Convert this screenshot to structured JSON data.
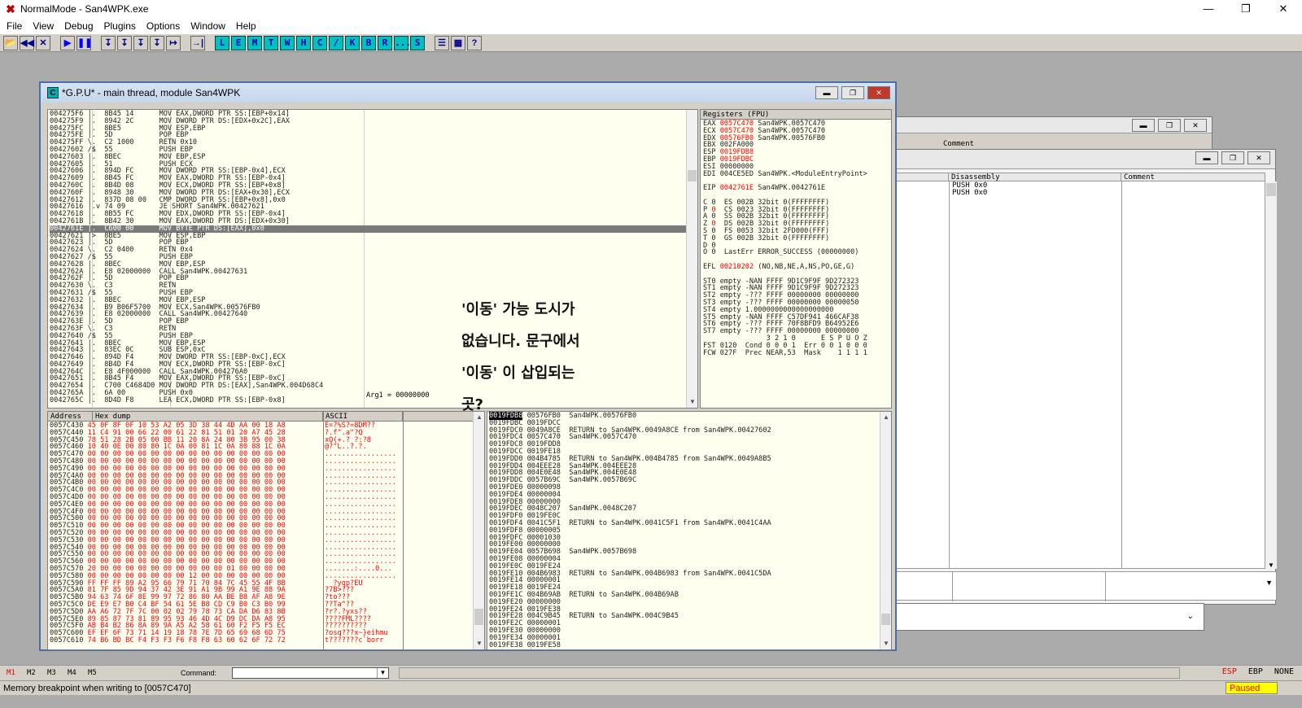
{
  "app": {
    "title": "NormalMode - San4WPK.exe",
    "icon": "x-logo-icon",
    "win_min": "—",
    "win_restore": "❐",
    "win_close": "✕"
  },
  "menu": [
    "File",
    "View",
    "Debug",
    "Plugins",
    "Options",
    "Window",
    "Help"
  ],
  "toolbar": {
    "left": [
      "📂",
      "◀◀",
      "✕",
      "▶",
      "❚❚",
      "↧",
      "↧",
      "↧",
      "↧",
      "↦",
      "→|"
    ],
    "letters": [
      "L",
      "E",
      "M",
      "T",
      "W",
      "H",
      "C",
      "/",
      "K",
      "B",
      "R",
      "...",
      "S"
    ],
    "right": [
      "☰",
      "▦",
      "?"
    ]
  },
  "cpu": {
    "title": "*G.P.U* - main thread, module San4WPK",
    "icon_letter": "C",
    "disasm": [
      "004275F6 |.  8B45 14      MOV EAX,DWORD PTR SS:[EBP+0x14]",
      "004275F9 |.  8942 2C      MOV DWORD PTR DS:[EDX+0x2C],EAX",
      "004275FC |.  8BE5         MOV ESP,EBP",
      "004275FE |.  5D           POP EBP",
      "004275FF \\.  C2 1000      RETN 0x10",
      "00427602 /$  55           PUSH EBP",
      "00427603 |.  8BEC         MOV EBP,ESP",
      "00427605 |.  51           PUSH ECX",
      "00427606 |.  894D FC      MOV DWORD PTR SS:[EBP-0x4],ECX",
      "00427609 |.  8B45 FC      MOV EAX,DWORD PTR SS:[EBP-0x4]",
      "0042760C |.  8B4D 08      MOV ECX,DWORD PTR SS:[EBP+0x8]",
      "0042760F |.  8948 30      MOV DWORD PTR DS:[EAX+0x30],ECX",
      "00427612 |.  837D 08 00   CMP DWORD PTR SS:[EBP+0x8],0x0",
      "00427616 |.v 74 09        JE SHORT San4WPK.00427621",
      "00427618 |.  8B55 FC      MOV EDX,DWORD PTR SS:[EBP-0x4]",
      "0042761B |.  8B42 30      MOV EAX,DWORD PTR DS:[EDX+0x30]",
      "0042761E |.  C600 00      MOV BYTE PTR DS:[EAX],0x0",
      "00427621 |>  8BE5         MOV ESP,EBP",
      "00427623 |.  5D           POP EBP",
      "00427624 \\.  C2 0400      RETN 0x4",
      "00427627 /$  55           PUSH EBP",
      "00427628 |.  8BEC         MOV EBP,ESP",
      "0042762A |.  E8 02000000  CALL San4WPK.00427631",
      "0042762F |.  5D           POP EBP",
      "00427630 \\.  C3           RETN",
      "00427631 /$  55           PUSH EBP",
      "00427632 |.  8BEC         MOV EBP,ESP",
      "00427634 |.  B9 B06F5700  MOV ECX,San4WPK.00576FB0",
      "00427639 |.  E8 02000000  CALL San4WPK.00427640",
      "0042763E |.  5D           POP EBP",
      "0042763F \\.  C3           RETN",
      "00427640 /$  55           PUSH EBP",
      "00427641 |.  8BEC         MOV EBP,ESP",
      "00427643 |.  83EC 0C      SUB ESP,0xC",
      "00427646 |.  894D F4      MOV DWORD PTR SS:[EBP-0xC],ECX",
      "00427649 |.  8B4D F4      MOV ECX,DWORD PTR SS:[EBP-0xC]",
      "0042764C |.  E8 4F000000  CALL San4WPK.004276A0",
      "00427651 |.  8B45 F4      MOV EAX,DWORD PTR SS:[EBP-0xC]",
      "00427654 |.  C700 C4684D0 MOV DWORD PTR DS:[EAX],San4WPK.004D68C4",
      "0042765A |.  6A 00        PUSH 0x0",
      "0042765C |.  8D4D F8      LEA ECX,DWORD PTR SS:[EBP-0x8]"
    ],
    "selected_row": 16,
    "arg1": "Arg1 = 00000000",
    "registers_header": "Registers (FPU)",
    "registers": [
      {
        "t": "EAX ",
        "v": "0057C470",
        "r": " San4WPK.0057C470",
        "red": true
      },
      {
        "t": "ECX ",
        "v": "0057C470",
        "r": " San4WPK.0057C470",
        "red": true
      },
      {
        "t": "EDX ",
        "v": "00576FB0",
        "r": " San4WPK.00576FB0",
        "red": true
      },
      {
        "t": "EBX ",
        "v": "002FA000",
        "r": "",
        "red": false
      },
      {
        "t": "ESP ",
        "v": "0019FDB8",
        "r": "",
        "red": true
      },
      {
        "t": "EBP ",
        "v": "0019FDBC",
        "r": "",
        "red": true
      },
      {
        "t": "ESI ",
        "v": "00000000",
        "r": "",
        "red": false
      },
      {
        "t": "EDI ",
        "v": "004CE5ED",
        "r": " San4WPK.<ModuleEntryPoint>",
        "red": false
      },
      {
        "t": "",
        "v": "",
        "r": "",
        "red": false
      },
      {
        "t": "EIP ",
        "v": "0042761E",
        "r": " San4WPK.0042761E",
        "red": true
      },
      {
        "t": "",
        "v": "",
        "r": "",
        "red": false
      },
      {
        "t": "C 0  ES 002B 32bit 0(FFFFFFFF)",
        "v": "",
        "r": "",
        "red": false
      },
      {
        "t": "P ",
        "v": "0",
        "r": "  CS 0023 32bit 0(FFFFFFFF)",
        "red": true
      },
      {
        "t": "A 0  SS 002B 32bit 0(FFFFFFFF)",
        "v": "",
        "r": "",
        "red": false
      },
      {
        "t": "Z ",
        "v": "0",
        "r": "  DS 002B 32bit 0(FFFFFFFF)",
        "red": true
      },
      {
        "t": "S 0  FS 0053 32bit 2FD000(FFF)",
        "v": "",
        "r": "",
        "red": false
      },
      {
        "t": "T 0  GS 002B 32bit 0(FFFFFFFF)",
        "v": "",
        "r": "",
        "red": false
      },
      {
        "t": "D 0",
        "v": "",
        "r": "",
        "red": false
      },
      {
        "t": "O 0  LastErr ERROR_SUCCESS (00000000)",
        "v": "",
        "r": "",
        "red": false
      },
      {
        "t": "",
        "v": "",
        "r": "",
        "red": false
      },
      {
        "t": "EFL ",
        "v": "00210202",
        "r": " (NO,NB,NE,A,NS,PO,GE,G)",
        "red": true
      },
      {
        "t": "",
        "v": "",
        "r": "",
        "red": false
      },
      {
        "t": "ST0 empty -NAN FFFF 9D1C9F9F 9D272323",
        "v": "",
        "r": "",
        "red": false
      },
      {
        "t": "ST1 empty -NAN FFFF 9D1C9F9F 9D272323",
        "v": "",
        "r": "",
        "red": false
      },
      {
        "t": "ST2 empty -??? FFFF 00000000 00000000",
        "v": "",
        "r": "",
        "red": false
      },
      {
        "t": "ST3 empty -??? FFFF 00000000 00000050",
        "v": "",
        "r": "",
        "red": false
      },
      {
        "t": "ST4 empty 1.0000000000000000000",
        "v": "",
        "r": "",
        "red": false
      },
      {
        "t": "ST5 empty -NAN FFFF C57DF941 466CAF38",
        "v": "",
        "r": "",
        "red": false
      },
      {
        "t": "ST6 empty -??? FFFF 70F8BFD9 B64952E6",
        "v": "",
        "r": "",
        "red": false
      },
      {
        "t": "ST7 empty -??? FFFF 00000000 00000000",
        "v": "",
        "r": "",
        "red": false
      },
      {
        "t": "               3 2 1 0      E S P U O Z",
        "v": "",
        "r": "",
        "red": false
      },
      {
        "t": "FST 0120  Cond 0 0 0 1  Err 0 0 1 0 0 0",
        "v": "",
        "r": "",
        "red": false
      },
      {
        "t": "FCW 027F  Prec NEAR,53  Mask    1 1 1 1",
        "v": "",
        "r": "",
        "red": false
      }
    ],
    "dump_headers": [
      "Address",
      "Hex dump",
      "ASCII"
    ],
    "dump": [
      "0057C430 45 0F 8F 0F 10 53 A2 05 3D 38 44 4D AA 00 18 A8",
      "0057C440 11 C4 91 00 66 22 00 61 22 81 51 01 20 A7 45 28",
      "0057C450 78 51 28 2B 05 00 BB 11 20 8A 24 80 3B 95 00 38",
      "0057C460 10 40 0E 00 80 80 1C 0A 00 81 1C 0A 80 88 1C 0A",
      "0057C470 00 00 00 00 00 00 00 00 00 00 00 00 00 00 00 00",
      "0057C480 00 00 00 00 00 00 00 00 00 00 00 00 00 00 00 00",
      "0057C490 00 00 00 00 00 00 00 00 00 00 00 00 00 00 00 00",
      "0057C4A0 00 00 00 00 00 00 00 00 00 00 00 00 00 00 00 00",
      "0057C4B0 00 00 00 00 00 00 00 00 00 00 00 00 00 00 00 00",
      "0057C4C0 00 00 00 00 00 00 00 00 00 00 00 00 00 00 00 00",
      "0057C4D0 00 00 00 00 00 00 00 00 00 00 00 00 00 00 00 00",
      "0057C4E0 00 00 00 00 00 00 00 00 00 00 00 00 00 00 00 00",
      "0057C4F0 00 00 00 00 00 00 00 00 00 00 00 00 00 00 00 00",
      "0057C500 00 00 00 00 00 00 00 00 00 00 00 00 00 00 00 00",
      "0057C510 00 00 00 00 00 00 00 00 00 00 00 00 00 00 00 00",
      "0057C520 00 00 00 00 00 00 00 00 00 00 00 00 00 00 00 00",
      "0057C530 00 00 00 00 00 00 00 00 00 00 00 00 00 00 00 00",
      "0057C540 00 00 00 00 00 00 00 00 00 00 00 00 00 00 00 00",
      "0057C550 00 00 00 00 00 00 00 00 00 00 00 00 00 00 00 00",
      "0057C560 00 00 00 00 00 00 00 00 00 00 00 00 00 00 00 00",
      "0057C570 20 00 00 00 00 00 00 00 00 00 00 01 00 00 00 00",
      "0057C580 00 00 00 00 00 00 00 00 12 00 00 00 00 00 00 00",
      "0057C590 FF FF FF 89 A2 95 66 79 71 70 84 7C 45 55 4F 8B",
      "0057C5A0 81 7F 85 9D 94 37 42 3E 91 A1 9B 99 A1 9E 88 9A",
      "0057C5B0 94 63 74 6F 8E 99 97 72 86 80 AA BE B8 AF A8 9E",
      "0057C5C0 DE E9 E7 B0 C4 BF 54 61 5E B8 CD C9 B0 C3 B0 99",
      "0057C5D0 AA A6 72 7F 7C 00 02 02 79 78 73 CA DA D6 83 8B",
      "0057C5E0 89 85 87 73 81 89 95 93 46 4D 4C D9 DC DA A8 95",
      "0057C5F0 AB B4 B2 86 8A 89 9A A5 A2 58 61 60 F2 F5 F5 EC",
      "0057C600 EF EF 6F 73 71 14 19 18 78 7E 7D 65 69 68 6D 75",
      "0057C610 74 B6 BD BC F4 F3 F3 F6 F8 F8 63 60 62 6F 72 72"
    ],
    "dump_red_rows": [
      0,
      1,
      2,
      3,
      4,
      5,
      6,
      7,
      8,
      9,
      10,
      11,
      12,
      13,
      14,
      15,
      16,
      17,
      18,
      19,
      20,
      21,
      22,
      23,
      24,
      25,
      26,
      27,
      28,
      29,
      30
    ],
    "ascii": [
      "E¤?%S?=8DM??",
      "\u0011?.f\".a\"?Q",
      "xQ(+.? ?:?8",
      "@?\"L..?.?.",
      ".................",
      ".................",
      ".................",
      ".................",
      ".................",
      ".................",
      ".................",
      ".................",
      ".................",
      ".................",
      ".................",
      ".................",
      ".................",
      ".................",
      ".................",
      ".................",
      ".......:....0...",
      ".................",
      "  ?yqp?EU",
      "?7B>???",
      "?to???",
      "??Ta^??",
      "?r?.?yxs??",
      "????FML????",
      "??????????",
      "?osq???x~}eihmu",
      "t???????c`borr"
    ],
    "stack": [
      {
        "a": "0019FDB8",
        "v": "00576FB0",
        "c": "San4WPK.00576FB0"
      },
      {
        "a": "0019FDBC",
        "v": "0019FDCC",
        "c": ""
      },
      {
        "a": "0019FDC0",
        "v": "0049A8CE",
        "c": "RETURN to San4WPK.0049A8CE from San4WPK.00427602"
      },
      {
        "a": "0019FDC4",
        "v": "0057C470",
        "c": "San4WPK.0057C470"
      },
      {
        "a": "0019FDC8",
        "v": "0019FDD8",
        "c": ""
      },
      {
        "a": "0019FDCC",
        "v": "0019FE18",
        "c": ""
      },
      {
        "a": "0019FDD0",
        "v": "004B4785",
        "c": "RETURN to San4WPK.004B4785 from San4WPK.0049A8B5"
      },
      {
        "a": "0019FDD4",
        "v": "004EEE28",
        "c": "San4WPK.004EEE28"
      },
      {
        "a": "0019FDD8",
        "v": "004E0E48",
        "c": "San4WPK.004E0E48"
      },
      {
        "a": "0019FDDC",
        "v": "0057B69C",
        "c": "San4WPK.0057B69C"
      },
      {
        "a": "0019FDE0",
        "v": "00000098",
        "c": ""
      },
      {
        "a": "0019FDE4",
        "v": "00000004",
        "c": ""
      },
      {
        "a": "0019FDE8",
        "v": "00000000",
        "c": ""
      },
      {
        "a": "0019FDEC",
        "v": "0048C207",
        "c": "San4WPK.0048C207"
      },
      {
        "a": "0019FDF0",
        "v": "0019FE0C",
        "c": ""
      },
      {
        "a": "0019FDF4",
        "v": "0041C5F1",
        "c": "RETURN to San4WPK.0041C5F1 from San4WPK.0041C4AA"
      },
      {
        "a": "0019FDF8",
        "v": "00000005",
        "c": ""
      },
      {
        "a": "0019FDFC",
        "v": "00001030",
        "c": ""
      },
      {
        "a": "0019FE00",
        "v": "00000000",
        "c": ""
      },
      {
        "a": "0019FE04",
        "v": "0057B698",
        "c": "San4WPK.0057B698"
      },
      {
        "a": "0019FE08",
        "v": "00000004",
        "c": ""
      },
      {
        "a": "0019FE0C",
        "v": "0019FE24",
        "c": ""
      },
      {
        "a": "0019FE10",
        "v": "004B6983",
        "c": "RETURN to San4WPK.004B6983 from San4WPK.0041C5DA"
      },
      {
        "a": "0019FE14",
        "v": "00000001",
        "c": ""
      },
      {
        "a": "0019FE18",
        "v": "0019FE24",
        "c": ""
      },
      {
        "a": "0019FE1C",
        "v": "004B69AB",
        "c": "RETURN to San4WPK.004B69AB"
      },
      {
        "a": "0019FE20",
        "v": "00000000",
        "c": ""
      },
      {
        "a": "0019FE24",
        "v": "0019FE38",
        "c": ""
      },
      {
        "a": "0019FE28",
        "v": "004C9B45",
        "c": "RETURN to San4WPK.004C9B45"
      },
      {
        "a": "0019FE2C",
        "v": "00000001",
        "c": ""
      },
      {
        "a": "0019FE30",
        "v": "00000000",
        "c": ""
      },
      {
        "a": "0019FE34",
        "v": "00000001",
        "c": ""
      },
      {
        "a": "0019FE38",
        "v": "0019FE58",
        "c": ""
      }
    ]
  },
  "overlay_text": [
    "'이동' 가능 도시가",
    "없습니다. 문구에서",
    "'이동' 이 삽입되는",
    "곳?"
  ],
  "back_window": {
    "top_title_fragment": "Comment",
    "headers": [
      "Disassembly",
      "Comment"
    ],
    "rows": [
      "PUSH 0x0",
      "PUSH 0x0"
    ]
  },
  "cmdbar": {
    "markers": [
      "M1",
      "M2",
      "M3",
      "M4",
      "M5"
    ],
    "label": "Command:",
    "right": [
      "ESP",
      "EBP",
      "NONE"
    ]
  },
  "status": {
    "message": "Memory breakpoint when writing to [0057C470]",
    "state": "Paused"
  }
}
